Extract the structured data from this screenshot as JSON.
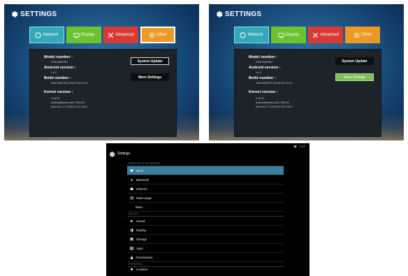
{
  "tv_settings": {
    "title": "SETTINGS",
    "tabs": [
      "Network",
      "Display",
      "Advanced",
      "Other"
    ],
    "info": {
      "model_label": "Model number :",
      "model_value": "S905 M82PRO",
      "android_label": "Android version :",
      "android_value": "4.4.2",
      "build_label": "Build number :",
      "build_value": "S905 M82PRO.20140716.V4.0.3",
      "kernel_label": "Kernel version :",
      "kernel_lines": [
        "3.10.33",
        "jenkins@jenkins-M5-7738 #13",
        "Wed Dec 17 20:58:22 CST 2014"
      ]
    },
    "buttons": {
      "system_update": "System Update",
      "more_settings": "More Settings"
    }
  },
  "android_settings": {
    "title": "Settings",
    "status_time": "1:27",
    "sections": [
      {
        "category": "WIRELESS & NETWORKS",
        "items": [
          "Wi-Fi",
          "Bluetooth",
          "ethernet",
          "Data usage",
          "More..."
        ]
      },
      {
        "category": "DEVICE",
        "items": [
          "Sound",
          "Display",
          "Storage",
          "Apps",
          "Permissions"
        ]
      },
      {
        "category": "PERSONAL",
        "items": [
          "Location"
        ]
      }
    ]
  },
  "colors": {
    "network": "#33a8b8",
    "display": "#6cc230",
    "advanced": "#d83a36",
    "other": "#eb9a25",
    "selected_row": "#3d7e9e",
    "highlight_button": "#7ec05a"
  }
}
